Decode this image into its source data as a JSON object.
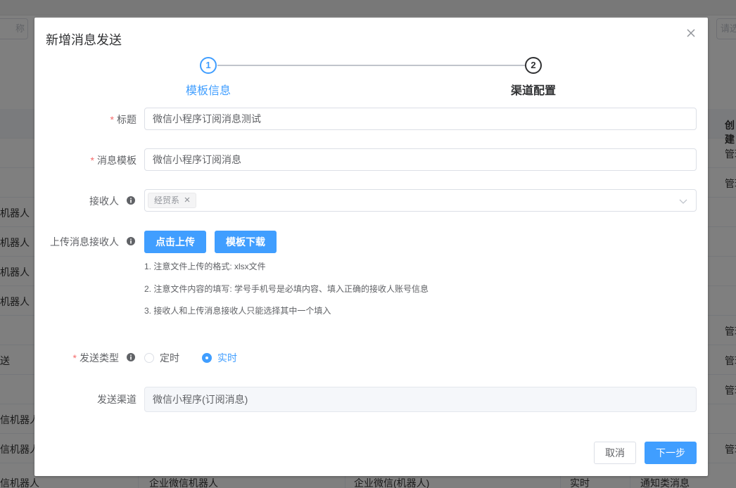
{
  "background": {
    "search_left_placeholder": "称",
    "search_right_placeholder": "请选",
    "table_header_right": "创建",
    "rows": [
      {
        "left": "",
        "right": "管理"
      },
      {
        "left": "",
        "right": "管理"
      },
      {
        "left": "机器人",
        "right": ""
      },
      {
        "left": "机器人",
        "right": ""
      },
      {
        "left": "机器人",
        "right": ""
      },
      {
        "left": "机器人",
        "right": ""
      },
      {
        "left": "",
        "right": "管理"
      },
      {
        "left": "送",
        "right": "管理"
      },
      {
        "left": "",
        "right": "管理"
      },
      {
        "left": "信机器人",
        "right": ""
      },
      {
        "left": "信机器人",
        "right": "管理"
      }
    ],
    "last_row": {
      "col1": "信机器人",
      "col2": "企业微信机器人",
      "col3": "企业微信(机器人)",
      "col4": "实时",
      "col5": "通知类消息"
    }
  },
  "dialog": {
    "title": "新增消息发送",
    "close_icon": "close-icon"
  },
  "steps": [
    {
      "number": "1",
      "title": "模板信息",
      "state": "active",
      "color": "#409eff"
    },
    {
      "number": "2",
      "title": "渠道配置",
      "state": "wait",
      "color": "#303133"
    }
  ],
  "form": {
    "required_mark": "*",
    "title_label": "标题",
    "title_value": "微信小程序订阅消息测试",
    "template_label": "消息模板",
    "template_value": "微信小程序订阅消息",
    "receiver_label": "接收人",
    "receiver_tag": "经贸系",
    "receiver_icon": "info-icon",
    "upload_label": "上传消息接收人",
    "upload_button": "点击上传",
    "download_button": "模板下载",
    "notes": [
      "1. 注意文件上传的格式: xlsx文件",
      "2. 注意文件内容的填写: 学号手机号是必填内容、填入正确的接收人账号信息",
      "3. 接收人和上传消息接收人只能选择其中一个填入"
    ],
    "send_type_label": "发送类型",
    "send_type_options": [
      {
        "label": "定时",
        "checked": false
      },
      {
        "label": "实时",
        "checked": true
      }
    ],
    "channel_label": "发送渠道",
    "channel_value": "微信小程序(订阅消息)"
  },
  "footer": {
    "cancel_label": "取消",
    "next_label": "下一步"
  },
  "colors": {
    "primary": "#409eff",
    "required": "#f56c6c",
    "text": "#606266",
    "title": "#303133"
  }
}
